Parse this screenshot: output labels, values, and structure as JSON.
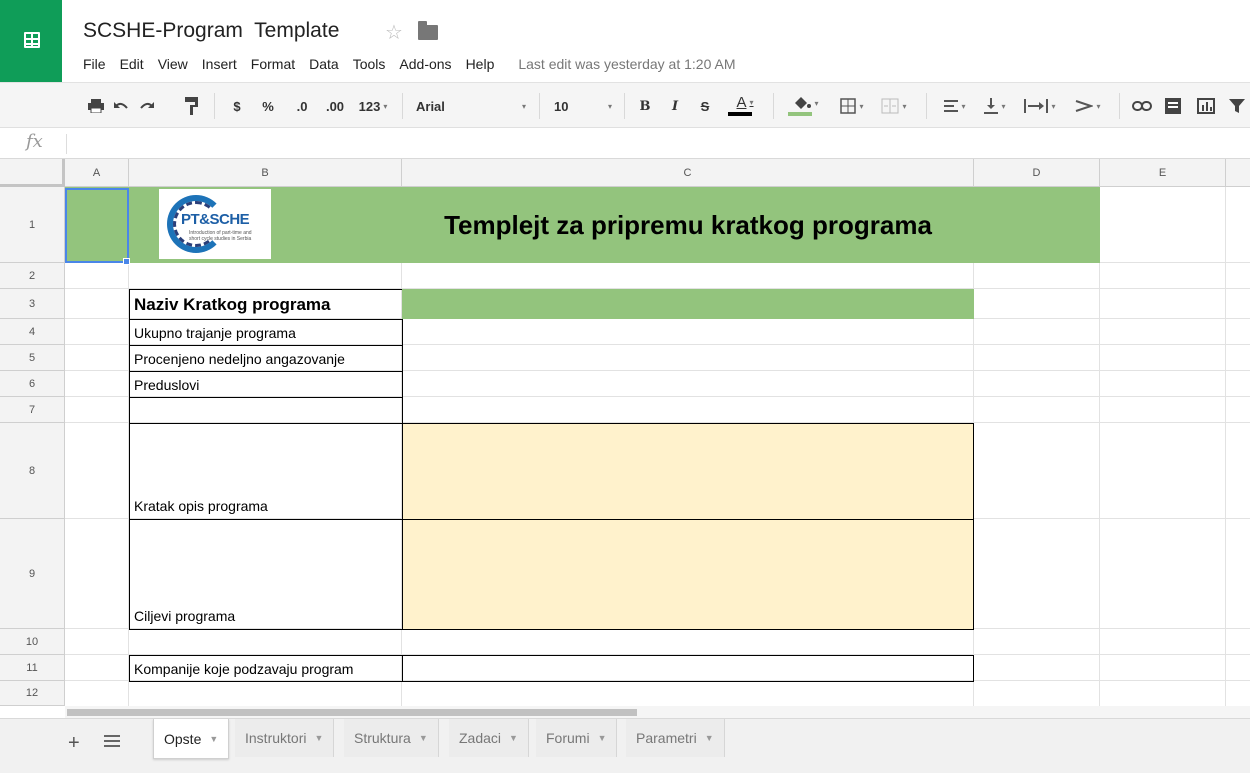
{
  "document": {
    "title": "SCSHE-Program  Template",
    "last_edit": "Last edit was yesterday at 1:20 AM"
  },
  "menu": [
    "File",
    "Edit",
    "View",
    "Insert",
    "Format",
    "Data",
    "Tools",
    "Add-ons",
    "Help"
  ],
  "toolbar": {
    "currency": "$",
    "percent": "%",
    "decrease_decimal": ".0",
    "increase_decimal": ".00",
    "more_formats": "123",
    "font": "Arial",
    "font_size": "10",
    "bold": "B",
    "italic": "I",
    "strike": "S",
    "text_color": "A"
  },
  "formula_bar": {
    "label": "fx",
    "value": ""
  },
  "columns": [
    "A",
    "B",
    "C",
    "D",
    "E"
  ],
  "rows": [
    "1",
    "2",
    "3",
    "4",
    "5",
    "6",
    "7",
    "8",
    "9",
    "10",
    "11",
    "12"
  ],
  "logo": {
    "text": "PT&SCHE",
    "subtitle": "Introduction of part-time and short cycle studies in Serbia"
  },
  "cells": {
    "C1": "Templejt za pripremu kratkog programa",
    "B3": "Naziv Kratkog programa",
    "B4": "Ukupno trajanje programa",
    "B5": "Procenjeno nedeljno angazovanje",
    "B6": "Preduslovi",
    "B8": "Kratak opis programa",
    "B9": "Ciljevi  programa",
    "B11": "Kompanije koje podzavaju program"
  },
  "sheets": [
    "Opste",
    "Instruktori",
    "Struktura",
    "Zadaci",
    "Forumi",
    "Parametri"
  ],
  "active_sheet": "Opste",
  "colors": {
    "app_green": "#0f9d58",
    "header_green": "#93c47d",
    "input_cream": "#fff2cc",
    "selection_blue": "#4a86e8"
  }
}
